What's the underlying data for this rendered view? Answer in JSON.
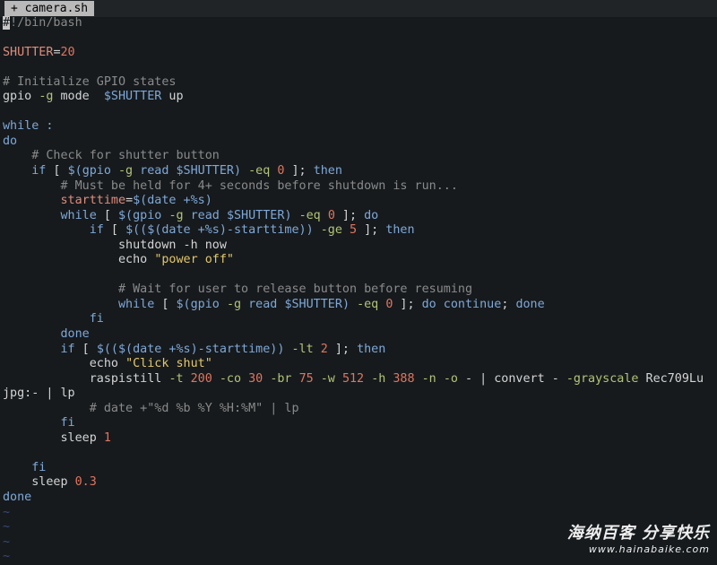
{
  "tab": {
    "title": "+ camera.sh"
  },
  "colors": {
    "background": "#161a1d",
    "plain": "#d4d4d4",
    "comment": "#8a8a8a",
    "keyword": "#7fa8d8",
    "variable": "#e08c7c",
    "number": "#e0755f",
    "string": "#e3c66b",
    "option": "#b3c476",
    "tilde": "#3a4a78"
  },
  "lines": [
    [
      [
        "#",
        "cursor"
      ],
      [
        "!/bin/bash",
        "comment"
      ]
    ],
    [],
    [
      [
        "SHUTTER",
        "variable"
      ],
      [
        "=",
        "plain"
      ],
      [
        "20",
        "number"
      ]
    ],
    [],
    [
      [
        "# Initialize GPIO states",
        "comment"
      ]
    ],
    [
      [
        "gpio ",
        "plain"
      ],
      [
        "-g",
        "option"
      ],
      [
        " mode  ",
        "plain"
      ],
      [
        "$SHUTTER",
        "keyword"
      ],
      [
        " up",
        "plain"
      ]
    ],
    [],
    [
      [
        "while :",
        "keyword"
      ]
    ],
    [
      [
        "do",
        "keyword"
      ]
    ],
    [
      [
        "    ",
        "plain"
      ],
      [
        "# Check for shutter button",
        "comment"
      ]
    ],
    [
      [
        "    ",
        "plain"
      ],
      [
        "if",
        "keyword"
      ],
      [
        " [ ",
        "plain"
      ],
      [
        "$(",
        "keyword"
      ],
      [
        "gpio ",
        "keyword"
      ],
      [
        "-g",
        "option"
      ],
      [
        " read ",
        "keyword"
      ],
      [
        "$SHUTTER",
        "keyword"
      ],
      [
        ") ",
        "keyword"
      ],
      [
        "-eq",
        "option"
      ],
      [
        " ",
        "plain"
      ],
      [
        "0",
        "number"
      ],
      [
        " ]; ",
        "plain"
      ],
      [
        "then",
        "keyword"
      ]
    ],
    [
      [
        "        ",
        "plain"
      ],
      [
        "# Must be held for 4+ seconds before shutdown is run...",
        "comment"
      ]
    ],
    [
      [
        "        ",
        "plain"
      ],
      [
        "starttime",
        "variable"
      ],
      [
        "=",
        "plain"
      ],
      [
        "$(",
        "keyword"
      ],
      [
        "date +%s",
        "keyword"
      ],
      [
        ")",
        "keyword"
      ]
    ],
    [
      [
        "        ",
        "plain"
      ],
      [
        "while",
        "keyword"
      ],
      [
        " [ ",
        "plain"
      ],
      [
        "$(",
        "keyword"
      ],
      [
        "gpio ",
        "keyword"
      ],
      [
        "-g",
        "option"
      ],
      [
        " read ",
        "keyword"
      ],
      [
        "$SHUTTER",
        "keyword"
      ],
      [
        ") ",
        "keyword"
      ],
      [
        "-eq",
        "option"
      ],
      [
        " ",
        "plain"
      ],
      [
        "0",
        "number"
      ],
      [
        " ]; ",
        "plain"
      ],
      [
        "do",
        "keyword"
      ]
    ],
    [
      [
        "            ",
        "plain"
      ],
      [
        "if",
        "keyword"
      ],
      [
        " [ ",
        "plain"
      ],
      [
        "$(($(",
        "keyword"
      ],
      [
        "date +%s",
        "keyword"
      ],
      [
        ")-starttime)) ",
        "keyword"
      ],
      [
        "-ge",
        "option"
      ],
      [
        " ",
        "plain"
      ],
      [
        "5",
        "number"
      ],
      [
        " ]; ",
        "plain"
      ],
      [
        "then",
        "keyword"
      ]
    ],
    [
      [
        "                ",
        "plain"
      ],
      [
        "shutdown -h now",
        "plain"
      ]
    ],
    [
      [
        "                ",
        "plain"
      ],
      [
        "echo ",
        "plain"
      ],
      [
        "\"power off\"",
        "string"
      ]
    ],
    [],
    [
      [
        "                ",
        "plain"
      ],
      [
        "# Wait for user to release button before resuming",
        "comment"
      ]
    ],
    [
      [
        "                ",
        "plain"
      ],
      [
        "while",
        "keyword"
      ],
      [
        " [ ",
        "plain"
      ],
      [
        "$(",
        "keyword"
      ],
      [
        "gpio ",
        "keyword"
      ],
      [
        "-g",
        "option"
      ],
      [
        " read ",
        "keyword"
      ],
      [
        "$SHUTTER",
        "keyword"
      ],
      [
        ") ",
        "keyword"
      ],
      [
        "-eq",
        "option"
      ],
      [
        " ",
        "plain"
      ],
      [
        "0",
        "number"
      ],
      [
        " ]; ",
        "plain"
      ],
      [
        "do",
        "keyword"
      ],
      [
        " continue",
        "keyword"
      ],
      [
        "; ",
        "plain"
      ],
      [
        "done",
        "keyword"
      ]
    ],
    [
      [
        "            ",
        "plain"
      ],
      [
        "fi",
        "keyword"
      ]
    ],
    [
      [
        "        ",
        "plain"
      ],
      [
        "done",
        "keyword"
      ]
    ],
    [
      [
        "        ",
        "plain"
      ],
      [
        "if",
        "keyword"
      ],
      [
        " [ ",
        "plain"
      ],
      [
        "$(($(",
        "keyword"
      ],
      [
        "date +%s",
        "keyword"
      ],
      [
        ")-starttime)) ",
        "keyword"
      ],
      [
        "-lt",
        "option"
      ],
      [
        " ",
        "plain"
      ],
      [
        "2",
        "number"
      ],
      [
        " ]; ",
        "plain"
      ],
      [
        "then",
        "keyword"
      ]
    ],
    [
      [
        "            ",
        "plain"
      ],
      [
        "echo ",
        "plain"
      ],
      [
        "\"Click shut\"",
        "string"
      ]
    ],
    [
      [
        "            ",
        "plain"
      ],
      [
        "raspistill ",
        "plain"
      ],
      [
        "-t",
        "option"
      ],
      [
        " ",
        "plain"
      ],
      [
        "200",
        "number"
      ],
      [
        " ",
        "plain"
      ],
      [
        "-co",
        "option"
      ],
      [
        " ",
        "plain"
      ],
      [
        "30",
        "number"
      ],
      [
        " ",
        "plain"
      ],
      [
        "-br",
        "option"
      ],
      [
        " ",
        "plain"
      ],
      [
        "75",
        "number"
      ],
      [
        " ",
        "plain"
      ],
      [
        "-w",
        "option"
      ],
      [
        " ",
        "plain"
      ],
      [
        "512",
        "number"
      ],
      [
        " ",
        "plain"
      ],
      [
        "-h",
        "option"
      ],
      [
        " ",
        "plain"
      ],
      [
        "388",
        "number"
      ],
      [
        " ",
        "plain"
      ],
      [
        "-n",
        "option"
      ],
      [
        " ",
        "plain"
      ],
      [
        "-o",
        "option"
      ],
      [
        " - | convert - ",
        "plain"
      ],
      [
        "-grayscale",
        "option"
      ],
      [
        " Rec709Lu",
        "plain"
      ]
    ],
    [
      [
        "jpg:- | lp",
        "plain"
      ]
    ],
    [
      [
        "            ",
        "plain"
      ],
      [
        "# date +\"%d %b %Y %H:%M\" | lp",
        "comment"
      ]
    ],
    [
      [
        "        ",
        "plain"
      ],
      [
        "fi",
        "keyword"
      ]
    ],
    [
      [
        "        ",
        "plain"
      ],
      [
        "sleep ",
        "plain"
      ],
      [
        "1",
        "number"
      ]
    ],
    [],
    [
      [
        "    ",
        "plain"
      ],
      [
        "fi",
        "keyword"
      ]
    ],
    [
      [
        "    ",
        "plain"
      ],
      [
        "sleep ",
        "plain"
      ],
      [
        "0.3",
        "number"
      ]
    ],
    [
      [
        "done",
        "keyword"
      ]
    ],
    [
      [
        "~",
        "tilde"
      ]
    ],
    [
      [
        "~",
        "tilde"
      ]
    ],
    [
      [
        "~",
        "tilde"
      ]
    ],
    [
      [
        "~",
        "tilde"
      ]
    ]
  ],
  "watermark": {
    "title": "海纳百客 分享快乐",
    "url": "www.hainabaike.com"
  }
}
